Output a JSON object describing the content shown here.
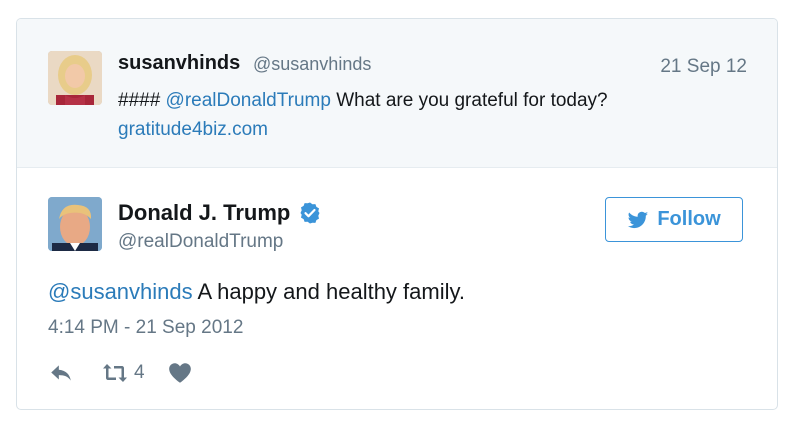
{
  "parent_tweet": {
    "display_name": "susanvhinds",
    "handle": "@susanvhinds",
    "date": "21 Sep 12",
    "text_prefix": "#### ",
    "mention": "@realDonaldTrump",
    "text_body": " What are you grateful for today?",
    "link": "gratitude4biz.com"
  },
  "tweet": {
    "display_name": "Donald J. Trump",
    "handle": "@realDonaldTrump",
    "follow_label": "Follow",
    "mention": "@susanvhinds",
    "text_body": " A happy and healthy family.",
    "timestamp": "4:14 PM - 21 Sep 2012",
    "retweet_count": "4"
  },
  "icons": {
    "verified": "verified-badge-icon",
    "follow_bird": "twitter-bird-icon",
    "reply": "reply-icon",
    "retweet": "retweet-icon",
    "like": "heart-icon"
  },
  "colors": {
    "link": "#2b7bb9",
    "follow": "#3b94d9",
    "muted": "#657786",
    "parent_bg": "#f5f8fa"
  }
}
